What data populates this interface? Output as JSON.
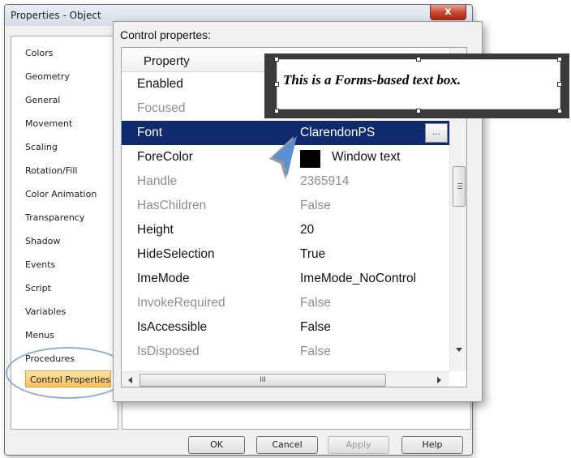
{
  "window": {
    "title": "Properties - Object",
    "close_icon": "x",
    "close_color": "#c7442b"
  },
  "left_tree": {
    "items": [
      {
        "label": "Colors"
      },
      {
        "label": "Geometry"
      },
      {
        "label": "General"
      },
      {
        "label": "Movement"
      },
      {
        "label": "Scaling"
      },
      {
        "label": "Rotation/Fill"
      },
      {
        "label": "Color Animation"
      },
      {
        "label": "Transparency"
      },
      {
        "label": "Shadow"
      },
      {
        "label": "Events"
      },
      {
        "label": "Script"
      },
      {
        "label": "Variables"
      },
      {
        "label": "Menus"
      },
      {
        "label": "Procedures"
      },
      {
        "label": "Control Properties"
      }
    ],
    "selected": "Control Properties",
    "selected_color": "#f7c15b"
  },
  "popup": {
    "title": "Control propertes:",
    "grid_header": "Property",
    "rows": [
      {
        "name": "Enabled",
        "value": "",
        "state": "normal"
      },
      {
        "name": "Focused",
        "value": "",
        "state": "dim"
      },
      {
        "name": "Font",
        "value": "ClarendonPS",
        "state": "selected"
      },
      {
        "name": "ForeColor",
        "value": "Window text",
        "state": "normal"
      },
      {
        "name": "Handle",
        "value": "2365914",
        "state": "dim"
      },
      {
        "name": "HasChildren",
        "value": "False",
        "state": "dim"
      },
      {
        "name": "Height",
        "value": "20",
        "state": "normal"
      },
      {
        "name": "HideSelection",
        "value": "True",
        "state": "normal"
      },
      {
        "name": "ImeMode",
        "value": "ImeMode_NoControl",
        "state": "normal"
      },
      {
        "name": "InvokeRequired",
        "value": "False",
        "state": "dim"
      },
      {
        "name": "IsAccessible",
        "value": "False",
        "state": "normal"
      },
      {
        "name": "IsDisposed",
        "value": "False",
        "state": "dim"
      }
    ],
    "ellipsis_label": "...",
    "forecolor_swatch": "#000000",
    "selected_row_color": "#0f2b6e",
    "hscroll_grip": "III"
  },
  "callout": {
    "text": "This is a Forms-based text box."
  },
  "buttons": {
    "ok": "OK",
    "cancel": "Cancel",
    "apply": "Apply",
    "help": "Help"
  }
}
